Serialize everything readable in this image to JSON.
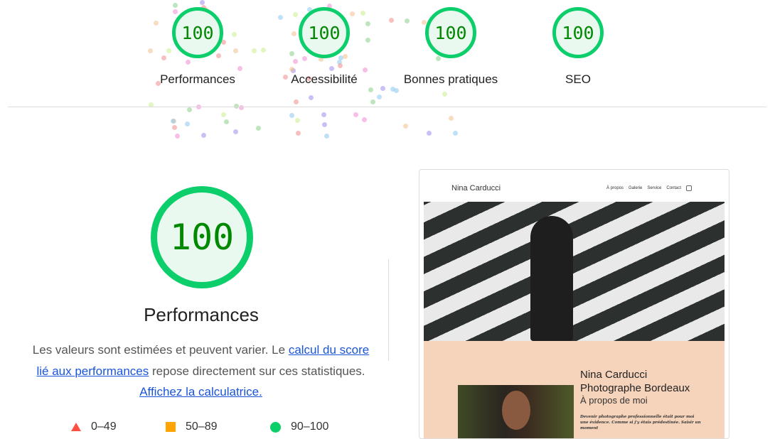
{
  "summary": [
    {
      "label": "Performances",
      "score": "100"
    },
    {
      "label": "Accessibilité",
      "score": "100"
    },
    {
      "label": "Bonnes pratiques",
      "score": "100"
    },
    {
      "label": "SEO",
      "score": "100"
    }
  ],
  "detail": {
    "score": "100",
    "title": "Performances",
    "desc_1": "Les valeurs sont estimées et peuvent varier. Le ",
    "link_1": "calcul du score lié aux performances",
    "desc_2": " repose directement sur ces statistiques. ",
    "link_2": "Affichez la calculatrice.",
    "legend": [
      "0–49",
      "50–89",
      "90–100"
    ]
  },
  "colors": {
    "pass": "#0cce6b",
    "pass_text": "#008800",
    "average": "#ffa400",
    "fail": "#ff4e42",
    "link": "#1a55d8"
  },
  "screenshot": {
    "site_name": "Nina Carducci",
    "nav": [
      "À propos",
      "Galerie",
      "Service",
      "Contact"
    ],
    "nav_icon": "instagram-icon",
    "heading_1": "Nina Carducci",
    "heading_2": "Photographe Bordeaux",
    "subheading": "À propos de moi",
    "paragraph": "Devenir photographe professionnelle était pour moi une évidence. Comme si j'y étais prédestinée. Saisir un moment"
  }
}
